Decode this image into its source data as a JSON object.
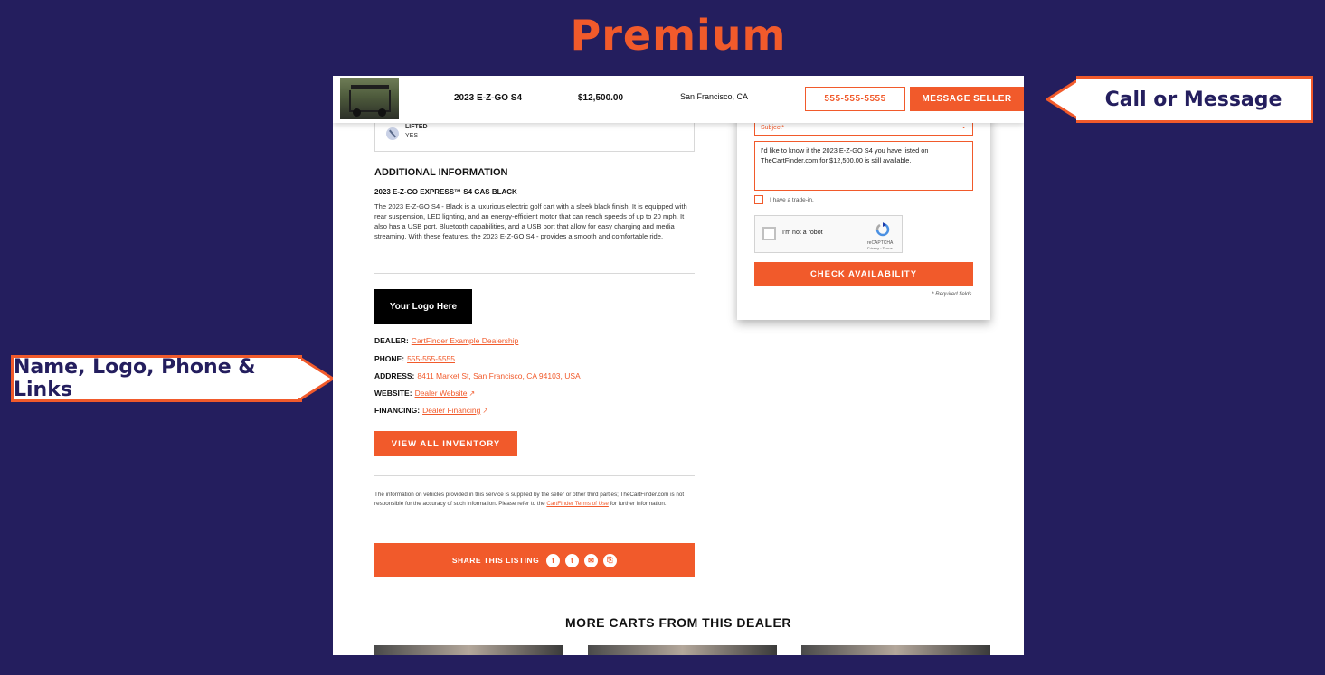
{
  "page": {
    "title": "Premium"
  },
  "callouts": {
    "right": "Call or Message",
    "left": "Name, Logo, Phone & Links"
  },
  "sticky": {
    "model": "2023 E-Z-GO S4",
    "price": "$12,500.00",
    "location": "San Francisco, CA",
    "phone_btn": "555-555-5555",
    "message_btn": "MESSAGE SELLER"
  },
  "specs": {
    "lifted_label": "LIFTED",
    "lifted_value": "YES"
  },
  "additional": {
    "heading": "ADDITIONAL INFORMATION",
    "subheading": "2023 E-Z-GO EXPRESS™ S4 GAS BLACK",
    "body": "The 2023 E-Z-GO S4 - Black is a luxurious electric golf cart with a sleek black finish. It is equipped with rear suspension, LED lighting, and an energy-efficient motor that can reach speeds of up to 20 mph. It also has a USB port. Bluetooth capabilities, and a USB port that allow for easy charging and media streaming. With these features, the 2023 E-Z-GO S4 - provides a smooth and comfortable ride."
  },
  "dealer": {
    "logo_text": "Your Logo Here",
    "dealer_label": "DEALER:",
    "dealer_value": "CartFinder Example Dealership",
    "phone_label": "PHONE:",
    "phone_value": "555-555-5555",
    "address_label": "ADDRESS:",
    "address_value": "8411 Market St, San Francisco, CA 94103, USA",
    "website_label": "WEBSITE:",
    "website_value": "Dealer Website",
    "financing_label": "FINANCING:",
    "financing_value": "Dealer Financing",
    "inventory_btn": "VIEW ALL INVENTORY"
  },
  "disclaimer": {
    "text": "The information on vehicles provided in this service is supplied by the seller or other third parties; TheCartFinder.com is not responsible for the accuracy of such information. Please refer to the",
    "link": "CartFinder Terms of Use",
    "tail": "for further information."
  },
  "share": {
    "label": "SHARE THIS LISTING"
  },
  "more": {
    "heading": "MORE CARTS FROM THIS DEALER"
  },
  "form": {
    "subject_placeholder": "Subject*",
    "message": "I'd like to know if the 2023 E-Z-GO S4 you have listed on TheCartFinder.com for $12,500.00 is still available.",
    "tradein_label": "I have a trade-in.",
    "captcha_label": "I'm not a robot",
    "captcha_brand": "reCAPTCHA",
    "captcha_links": "Privacy - Terms",
    "check_btn": "CHECK AVAILABILITY",
    "required_note": "* Required fields."
  },
  "colors": {
    "accent": "#f15a2b",
    "background": "#241e5e"
  }
}
